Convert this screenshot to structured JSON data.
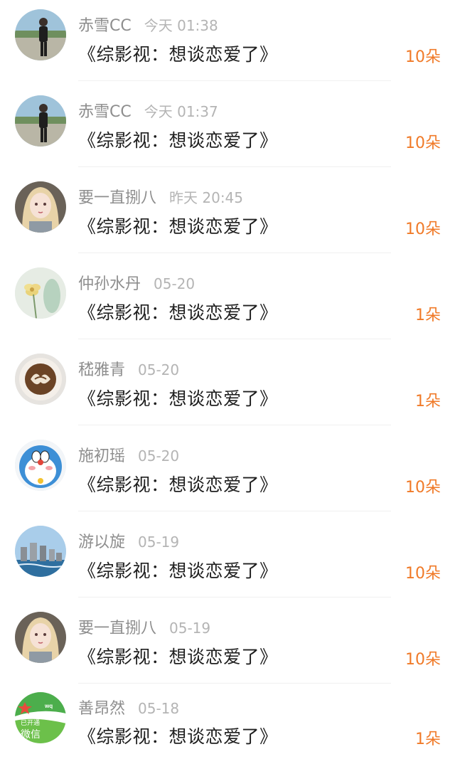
{
  "accent_color": "#f07a28",
  "items": [
    {
      "name": "赤雪CC",
      "time": "今天 01:38",
      "title": "《综影视：想谈恋爱了》",
      "gift": "10朵",
      "avatar_icon": "person-photo-avatar"
    },
    {
      "name": "赤雪CC",
      "time": "今天 01:37",
      "title": "《综影视：想谈恋爱了》",
      "gift": "10朵",
      "avatar_icon": "person-photo-avatar"
    },
    {
      "name": "要一直捌八",
      "time": "昨天 20:45",
      "title": "《综影视：想谈恋爱了》",
      "gift": "10朵",
      "avatar_icon": "anime-girl-avatar"
    },
    {
      "name": "仲孙水丹",
      "time": "05-20",
      "title": "《综影视：想谈恋爱了》",
      "gift": "1朵",
      "avatar_icon": "flower-avatar"
    },
    {
      "name": "嵇雅青",
      "time": "05-20",
      "title": "《综影视：想谈恋爱了》",
      "gift": "1朵",
      "avatar_icon": "coffee-latte-avatar"
    },
    {
      "name": "施初瑶",
      "time": "05-20",
      "title": "《综影视：想谈恋爱了》",
      "gift": "10朵",
      "avatar_icon": "doraemon-avatar"
    },
    {
      "name": "游以旋",
      "time": "05-19",
      "title": "《综影视：想谈恋爱了》",
      "gift": "10朵",
      "avatar_icon": "city-skyline-avatar"
    },
    {
      "name": "要一直捌八",
      "time": "05-19",
      "title": "《综影视：想谈恋爱了》",
      "gift": "10朵",
      "avatar_icon": "anime-girl-avatar"
    },
    {
      "name": "善昂然",
      "time": "05-18",
      "title": "《综影视：想谈恋爱了》",
      "gift": "1朵",
      "avatar_icon": "wechat-logo-avatar",
      "avatar_text": [
        "已开通",
        "微信"
      ]
    }
  ]
}
